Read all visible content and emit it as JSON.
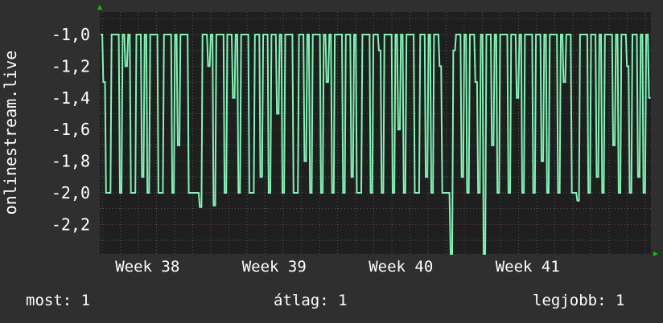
{
  "chart_data": {
    "type": "line",
    "ylabel": "onlinestream.live",
    "ylim": [
      -2.386,
      -0.858
    ],
    "y_ticks": [
      "-1,0",
      "-1,2",
      "-1,4",
      "-1,6",
      "-1,8",
      "-2,0",
      "-2,2"
    ],
    "y_tick_values": [
      -1.0,
      -1.2,
      -1.4,
      -1.6,
      -1.8,
      -2.0,
      -2.2
    ],
    "x_ticks": [
      "Week 38",
      "Week 39",
      "Week 40",
      "Week 41"
    ],
    "grid": true,
    "series": [
      {
        "name": "onlinestream.live",
        "color": "#7ff5b5",
        "values": [
          -1,
          -1.3,
          -2,
          -2,
          -1,
          -1,
          -1,
          -2,
          -1,
          -1.2,
          -1,
          -2,
          -2,
          -1,
          -1,
          -1.9,
          -1,
          -2,
          -1,
          -1,
          -1,
          -2,
          -2,
          -1,
          -1,
          -1,
          -2,
          -1,
          -1.7,
          -1,
          -1,
          -1,
          -2,
          -2,
          -2,
          -2,
          -2.09,
          -1,
          -1,
          -1.2,
          -1,
          -2.08,
          -1,
          -1,
          -1,
          -2,
          -1,
          -1,
          -1.4,
          -1,
          -2,
          -1,
          -1,
          -1,
          -2,
          -2,
          -1,
          -1,
          -1.9,
          -1,
          -1,
          -2,
          -1,
          -1,
          -1.5,
          -1,
          -2,
          -1,
          -1,
          -1,
          -2,
          -2,
          -1,
          -1,
          -1.8,
          -1,
          -2,
          -1,
          -1,
          -1,
          -2,
          -1,
          -1.3,
          -1,
          -2,
          -1,
          -1,
          -1,
          -2,
          -1,
          -1,
          -1.9,
          -1,
          -2,
          -2,
          -1,
          -1,
          -1,
          -2,
          -1,
          -1,
          -1.1,
          -2,
          -1,
          -1,
          -1,
          -2,
          -1,
          -1.6,
          -1,
          -2,
          -1,
          -1,
          -1,
          -2,
          -2,
          -1,
          -1,
          -1.9,
          -1,
          -2,
          -1,
          -1,
          -1.2,
          -2,
          -2,
          -2,
          -2.4,
          -1.1,
          -1,
          -1,
          -1.9,
          -1,
          -2,
          -1,
          -1,
          -1.3,
          -2,
          -1,
          -2.4,
          -1,
          -1,
          -1.7,
          -1,
          -2,
          -1,
          -1,
          -1,
          -2,
          -1,
          -1,
          -1.4,
          -1,
          -2,
          -1,
          -1,
          -1,
          -2,
          -1,
          -1,
          -1.8,
          -1,
          -2,
          -1,
          -1,
          -1,
          -2,
          -1,
          -1.3,
          -1,
          -1,
          -2,
          -2,
          -2.05,
          -1,
          -1,
          -1,
          -2,
          -1,
          -1,
          -1.9,
          -1,
          -2,
          -1,
          -1,
          -1,
          -1.7,
          -1,
          -2,
          -1,
          -1,
          -1.2,
          -2,
          -1,
          -1,
          -1.9,
          -1,
          -2,
          -1,
          -1.4
        ]
      }
    ]
  },
  "legend": {
    "current": "most: 1",
    "average": "átlag: 1",
    "max": "legjobb: 1"
  }
}
